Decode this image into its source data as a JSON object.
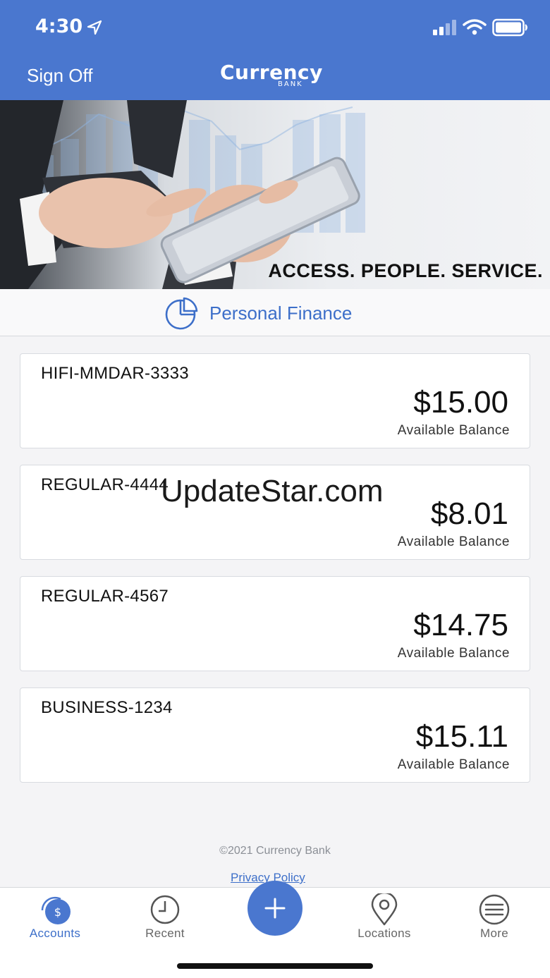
{
  "status": {
    "time": "4:30"
  },
  "header": {
    "sign_off": "Sign Off",
    "logo_main": "Currency",
    "logo_sub": "BANK"
  },
  "banner": {
    "tagline": "ACCESS. PEOPLE. SERVICE."
  },
  "personal_finance": {
    "label": "Personal Finance"
  },
  "accounts": [
    {
      "name": "HIFI-MMDAR-3333",
      "amount": "$15.00",
      "caption": "Available Balance"
    },
    {
      "name": "REGULAR-4444",
      "amount": "$8.01",
      "caption": "Available Balance"
    },
    {
      "name": "REGULAR-4567",
      "amount": "$14.75",
      "caption": "Available Balance"
    },
    {
      "name": "BUSINESS-1234",
      "amount": "$15.11",
      "caption": "Available Balance"
    }
  ],
  "watermark": "UpdateStar.com",
  "footer": {
    "copyright": "©2021 Currency Bank",
    "privacy": "Privacy Policy"
  },
  "tabs": {
    "accounts": "Accounts",
    "recent": "Recent",
    "locations": "Locations",
    "more": "More"
  },
  "colors": {
    "brand": "#4a77cf",
    "accent_text": "#3d6fc9"
  }
}
